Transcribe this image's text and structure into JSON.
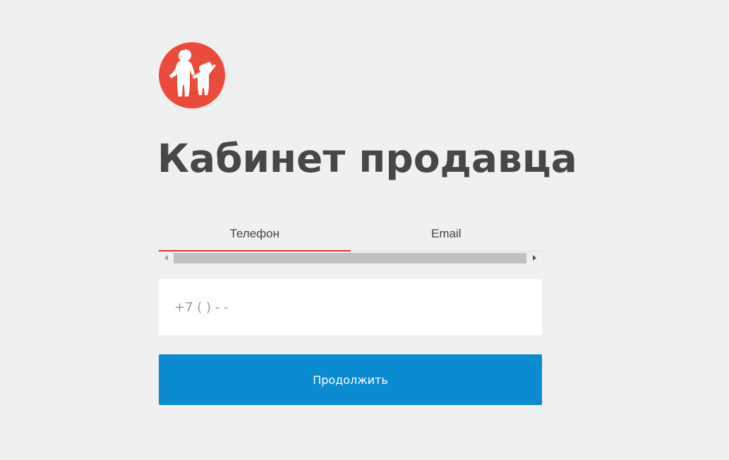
{
  "header": {
    "logo_icon": "family-silhouette-logo-icon",
    "title": "Кабинет продавца"
  },
  "tabs": [
    {
      "label": "Телефон",
      "active": true
    },
    {
      "label": "Email",
      "active": false
    }
  ],
  "form": {
    "phone_placeholder": "+7 ( ) - -",
    "phone_value": "",
    "submit_label": "Продолжить"
  },
  "colors": {
    "background": "#f0f0f1",
    "logo": "#ec4b3c",
    "active_tab_underline": "#e03030",
    "button": "#0a8bd2",
    "title_text": "#474747"
  }
}
